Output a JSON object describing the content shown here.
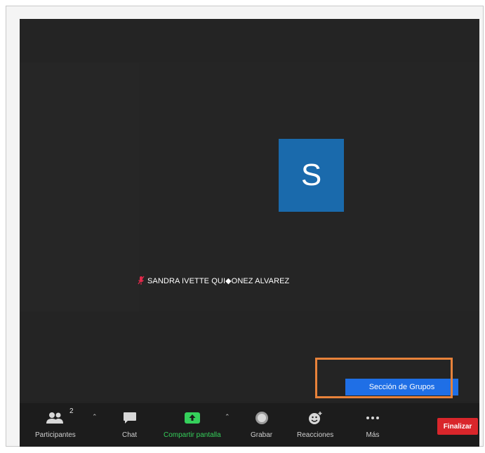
{
  "participant": {
    "initial": "S",
    "name": "SANDRA IVETTE QUI◆ONEZ ALVAREZ"
  },
  "menu": {
    "breakout_label": "Sección de Grupos"
  },
  "toolbar": {
    "participants_label": "Participantes",
    "participants_count": "2",
    "chat_label": "Chat",
    "share_label": "Compartir pantalla",
    "record_label": "Grabar",
    "reactions_label": "Reacciones",
    "more_label": "Más",
    "end_label": "Finalizar"
  },
  "colors": {
    "avatar_bg": "#1a6aac",
    "share_green": "#35d05b",
    "end_red": "#d9262b",
    "menu_blue": "#1f6fe6",
    "highlight_orange": "#e8823a"
  }
}
